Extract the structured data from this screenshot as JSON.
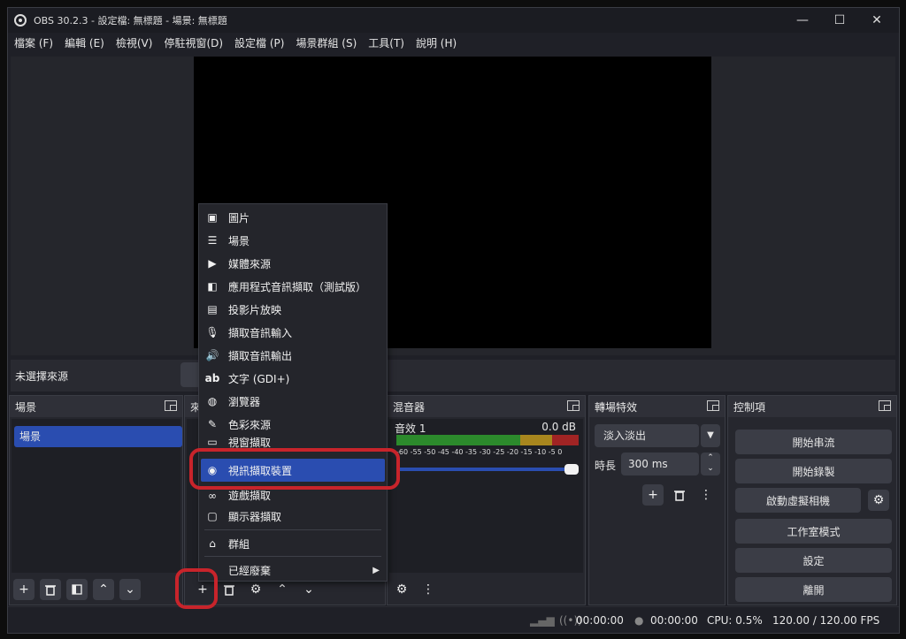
{
  "window": {
    "title": "OBS 30.2.3 - 設定檔: 無標題 - 場景: 無標題",
    "controls": {
      "minimize": "—",
      "maximize": "☐",
      "close": "✕"
    }
  },
  "menubar": [
    "檔案 (F)",
    "編輯 (E)",
    "檢視(V)",
    "停駐視窗(D)",
    "設定檔 (P)",
    "場景群組 (S)",
    "工具(T)",
    "說明 (H)"
  ],
  "source_bar": {
    "no_source": "未選擇來源"
  },
  "scenes": {
    "title": "場景",
    "items": [
      "場景"
    ]
  },
  "sources": {
    "title": "來"
  },
  "mixer": {
    "title": "混音器",
    "track_name": "音效 1",
    "track_db": "0.0 dB",
    "ticks": "-60 -55 -50 -45 -40 -35 -30 -25 -20 -15 -10 -5 0"
  },
  "transitions": {
    "title": "轉場特效",
    "selected": "淡入淡出",
    "duration_label": "時長",
    "duration_value": "300 ms"
  },
  "controls": {
    "title": "控制項",
    "start_streaming": "開始串流",
    "start_recording": "開始錄製",
    "start_virtual_cam": "啟動虛擬相機",
    "studio_mode": "工作室模式",
    "settings": "設定",
    "exit": "離開"
  },
  "status": {
    "stream_time": "00:00:00",
    "rec_time": "00:00:00",
    "cpu": "CPU: 0.5%",
    "fps": "120.00 / 120.00 FPS"
  },
  "add_source_menu": {
    "items": [
      {
        "label": "圖片",
        "icon": "image-icon"
      },
      {
        "label": "場景",
        "icon": "list-icon"
      },
      {
        "label": "媒體來源",
        "icon": "play-icon"
      },
      {
        "label": "應用程式音訊擷取（測試版）",
        "icon": "app-audio-icon"
      },
      {
        "label": "投影片放映",
        "icon": "slideshow-icon"
      },
      {
        "label": "擷取音訊輸入",
        "icon": "microphone-icon"
      },
      {
        "label": "擷取音訊輸出",
        "icon": "speaker-icon"
      },
      {
        "label": "文字 (GDI+)",
        "icon": "text-icon"
      },
      {
        "label": "瀏覽器",
        "icon": "globe-icon"
      },
      {
        "label": "色彩來源",
        "icon": "brush-icon"
      },
      {
        "label": "視窗擷取",
        "icon": "window-icon"
      },
      {
        "label": "視訊擷取裝置",
        "icon": "camera-icon"
      },
      {
        "label": "遊戲擷取",
        "icon": "gamepad-icon"
      },
      {
        "label": "顯示器擷取",
        "icon": "monitor-icon"
      },
      {
        "label": "群組",
        "icon": "folder-icon"
      },
      {
        "label": "已經廢棄",
        "icon": "none"
      }
    ],
    "selected": "視訊擷取裝置"
  },
  "colors": {
    "accent": "#2a4db0",
    "highlight": "#c8242b",
    "meter_green": "#2c8a2c",
    "meter_yellow": "#a8861e",
    "meter_red": "#a02424"
  }
}
